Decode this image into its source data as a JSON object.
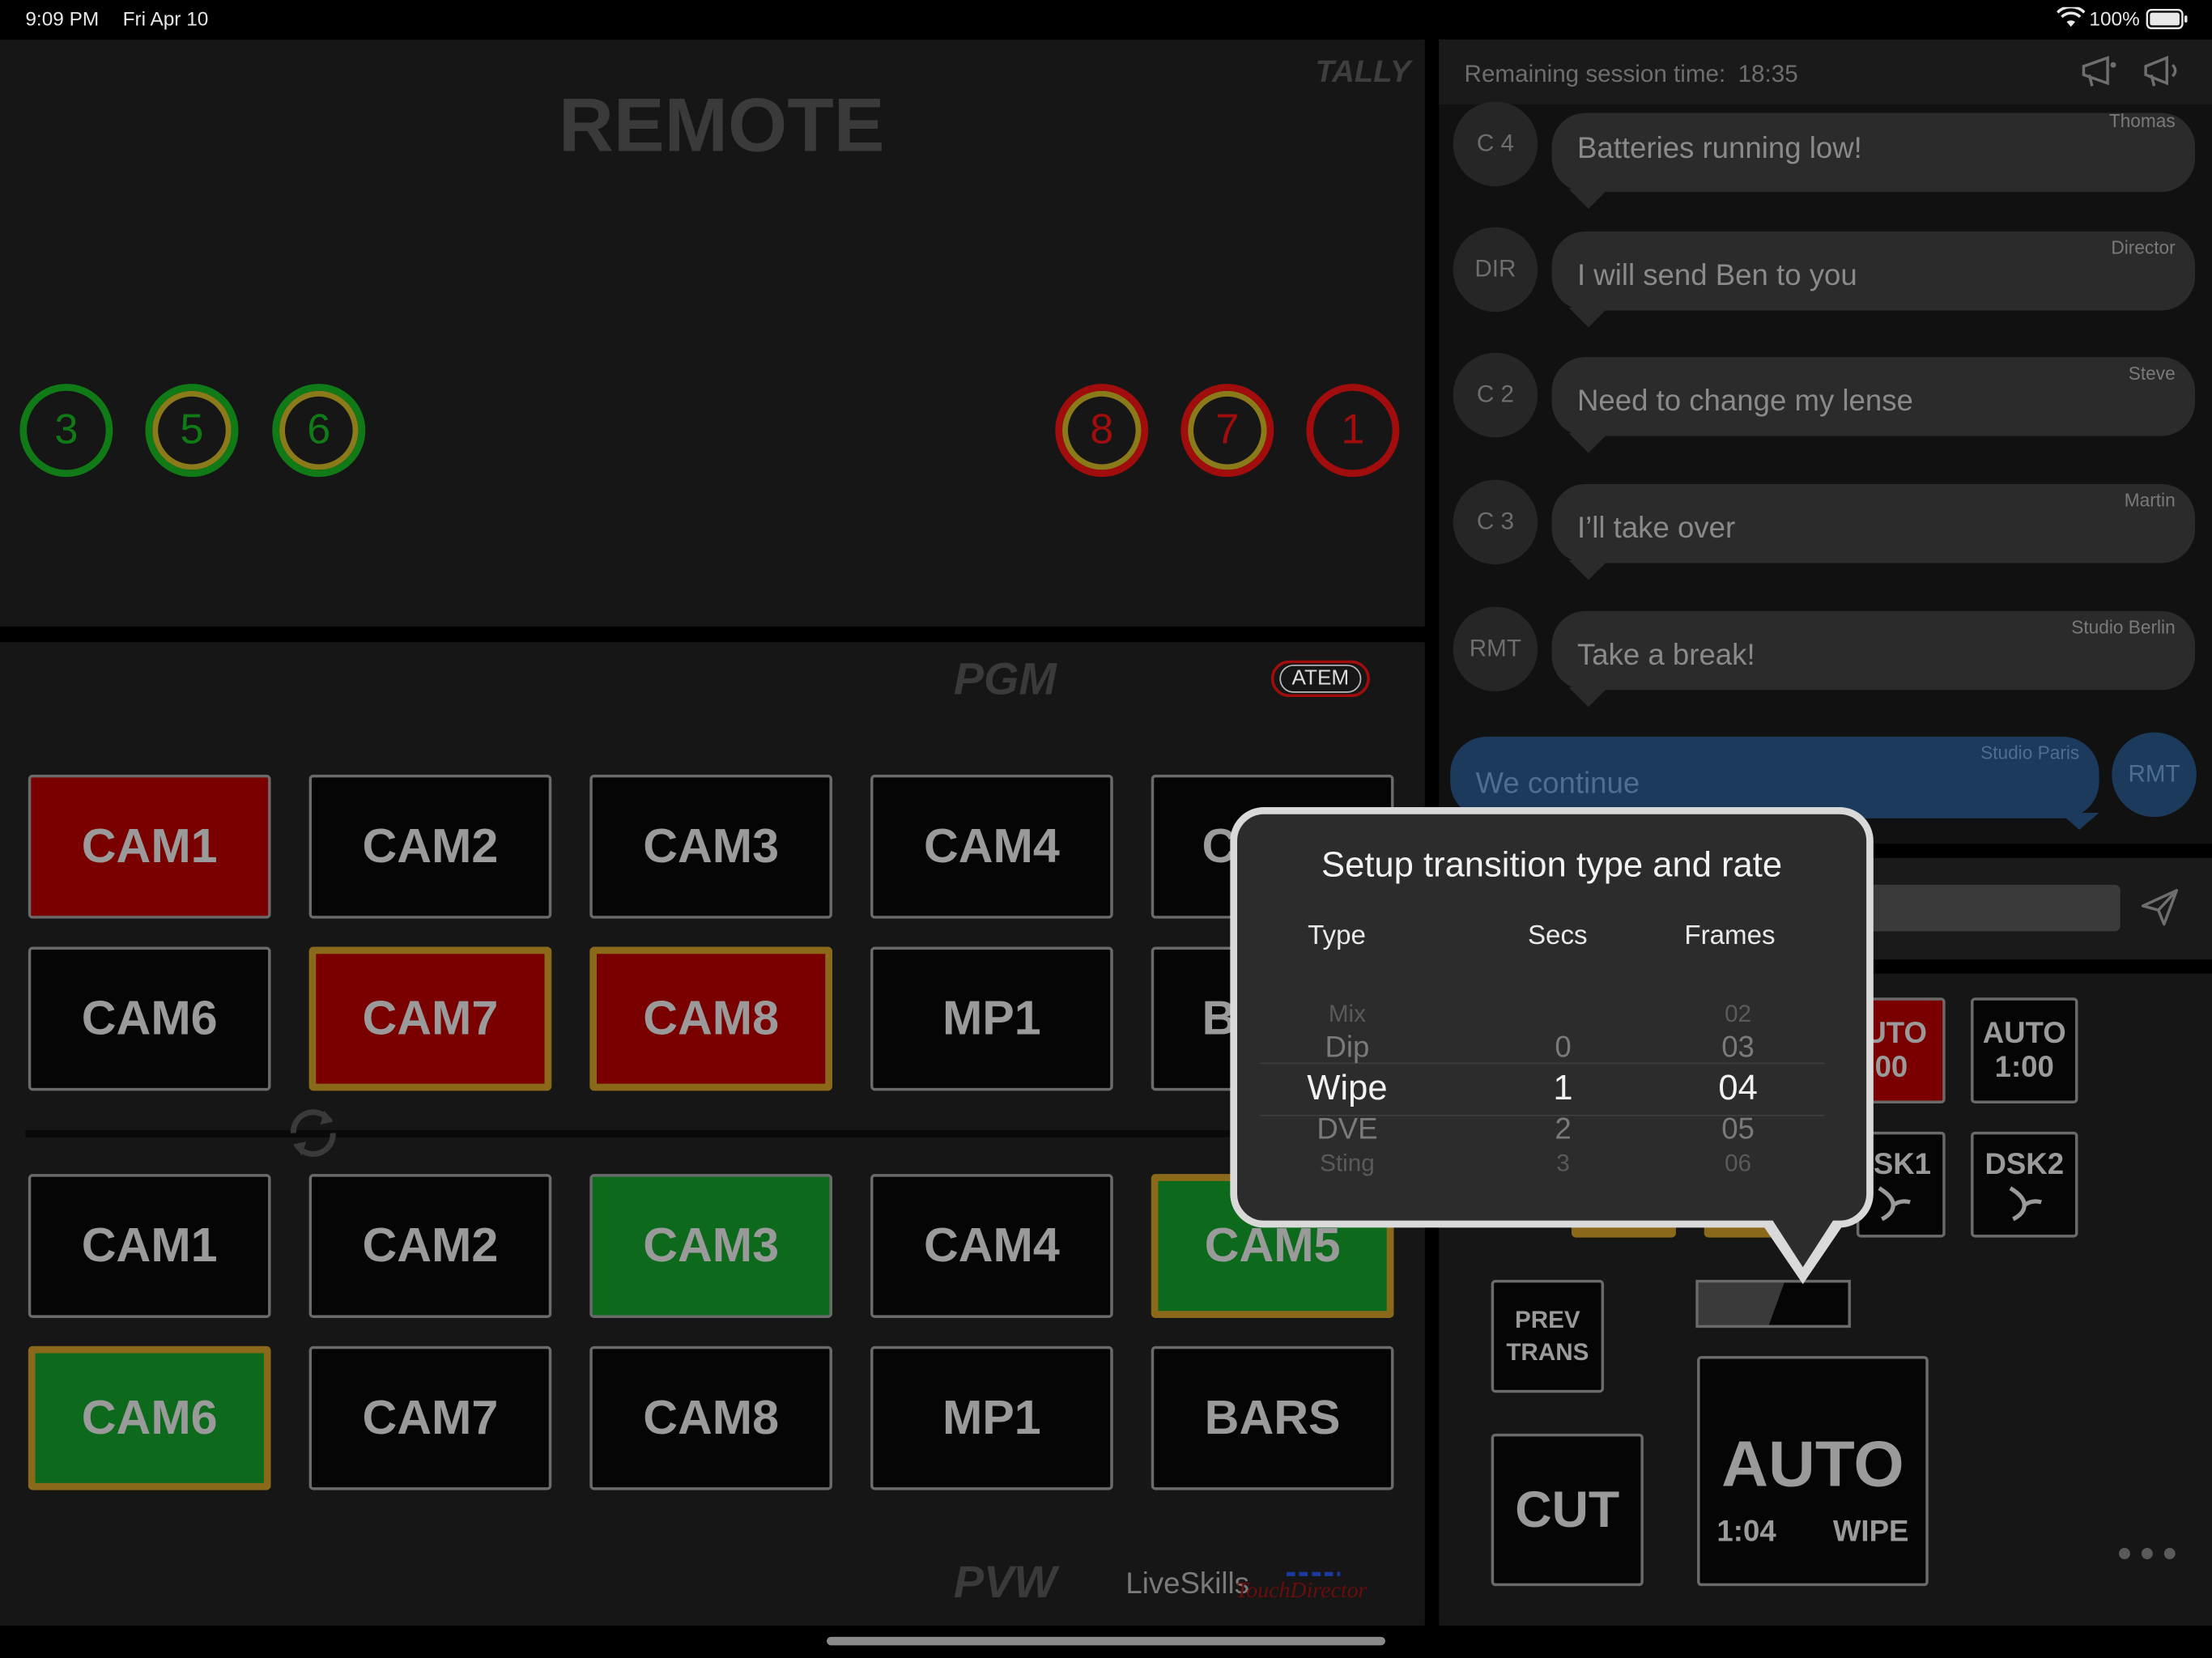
{
  "status_bar": {
    "time": "9:09 PM",
    "date": "Fri Apr 10",
    "battery": "100%"
  },
  "tally": {
    "brand": "TALLY",
    "title": "REMOTE",
    "preview_circles": [
      "3",
      "5",
      "6"
    ],
    "program_circles": [
      "8",
      "7",
      "1"
    ],
    "colors": {
      "green": "#0f7a16",
      "red": "#a10d0d",
      "gold": "#8a7a1a"
    }
  },
  "chat": {
    "session_label": "Remaining session time:",
    "session_time": "18:35",
    "messages": [
      {
        "from": "C 4",
        "sender": "Thomas",
        "text": "Batteries running low!"
      },
      {
        "from": "DIR",
        "sender": "Director",
        "text": "I will send Ben to you"
      },
      {
        "from": "C 2",
        "sender": "Steve",
        "text": "Need to change my lense"
      },
      {
        "from": "C 3",
        "sender": "Martin",
        "text": "I’ll take over"
      },
      {
        "from": "RMT",
        "sender": "Studio Berlin",
        "text": "Take a break!"
      }
    ],
    "own_message": {
      "from": "RMT",
      "sender": "Studio Paris",
      "text": "We continue"
    }
  },
  "switcher": {
    "pgm_label": "PGM",
    "pvw_label": "PVW",
    "atem_label": "ATEM",
    "pgm_row1": [
      "CAM1",
      "CAM2",
      "CAM3",
      "CAM4",
      "C"
    ],
    "pgm_row2": [
      "CAM6",
      "CAM7",
      "CAM8",
      "MP1",
      "B"
    ],
    "pvw_row1": [
      "CAM1",
      "CAM2",
      "CAM3",
      "CAM4",
      "CAM5"
    ],
    "pvw_row2": [
      "CAM6",
      "CAM7",
      "CAM8",
      "MP1",
      "BARS"
    ],
    "brand_text": "LiveSkills",
    "brand_script": "TouchDirector"
  },
  "controls": {
    "auto1_line1": "UTO",
    "auto1_line2": ":00",
    "auto2_line1": "AUTO",
    "auto2_line2": "1:00",
    "dsk1": "SK1",
    "dsk2": "DSK2",
    "prev_trans_line1": "PREV",
    "prev_trans_line2": "TRANS",
    "cut": "CUT",
    "auto_main": "AUTO",
    "auto_rate": "1:04",
    "auto_type": "WIPE"
  },
  "popover": {
    "title": "Setup transition type and rate",
    "col_type": "Type",
    "col_secs": "Secs",
    "col_frames": "Frames",
    "types": [
      "Mix",
      "Dip",
      "Wipe",
      "DVE",
      "Sting"
    ],
    "secs": [
      "0",
      "1",
      "2",
      "3"
    ],
    "frames": [
      "02",
      "03",
      "04",
      "05",
      "06"
    ]
  }
}
